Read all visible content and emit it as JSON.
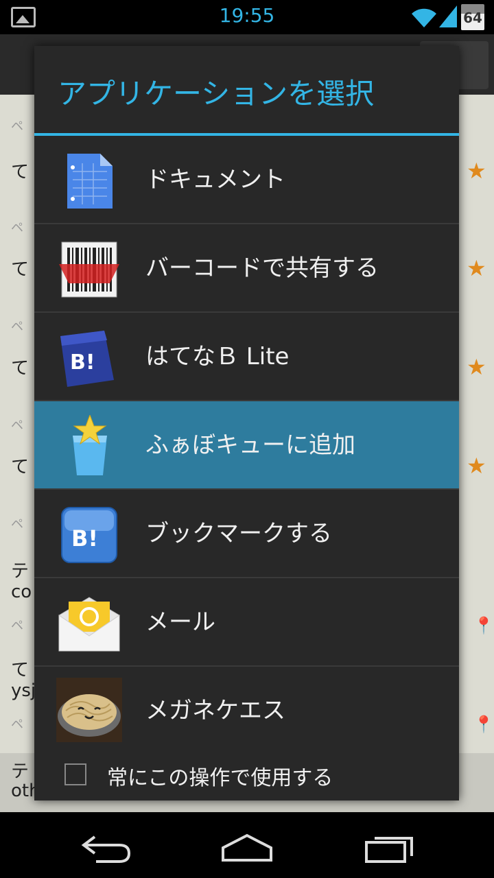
{
  "status_bar": {
    "time": "19:55",
    "battery_level": "64",
    "battery_fraction": 0.64
  },
  "background_app": {
    "rows": [
      {
        "text": "ペ"
      },
      {
        "text": "て"
      },
      {
        "text": "ペ"
      },
      {
        "text": "て"
      },
      {
        "text": "ペ"
      },
      {
        "text": "て"
      },
      {
        "text": "ペ"
      },
      {
        "text": "て"
      },
      {
        "text": "ペ"
      },
      {
        "text": "テ"
      },
      {
        "text": "co"
      },
      {
        "text": "ペ"
      },
      {
        "text": "て"
      },
      {
        "text": "ysj"
      },
      {
        "text": "ペ"
      },
      {
        "text": "テ"
      },
      {
        "text": "oth"
      }
    ]
  },
  "dialog": {
    "title": "アプリケーションを選択",
    "items": [
      {
        "label": "ドキュメント",
        "icon": "docs-icon"
      },
      {
        "label": "バーコードで共有する",
        "icon": "barcode-icon"
      },
      {
        "label": "はてなＢ Lite",
        "icon": "hatena-b-lite-icon"
      },
      {
        "label": "ふぁぼキューに追加",
        "icon": "favo-queue-icon",
        "selected": true
      },
      {
        "label": "ブックマークする",
        "icon": "hatena-bookmark-icon"
      },
      {
        "label": "メール",
        "icon": "mail-icon"
      },
      {
        "label": "メガネケエス",
        "icon": "megane-kes-icon"
      }
    ],
    "always_use_label": "常にこの操作で使用する",
    "always_use_checked": false
  },
  "colors": {
    "accent": "#33b5e5",
    "selected_row": "#2e7c9e",
    "dialog_bg": "#282828",
    "star": "#e08a1e"
  }
}
